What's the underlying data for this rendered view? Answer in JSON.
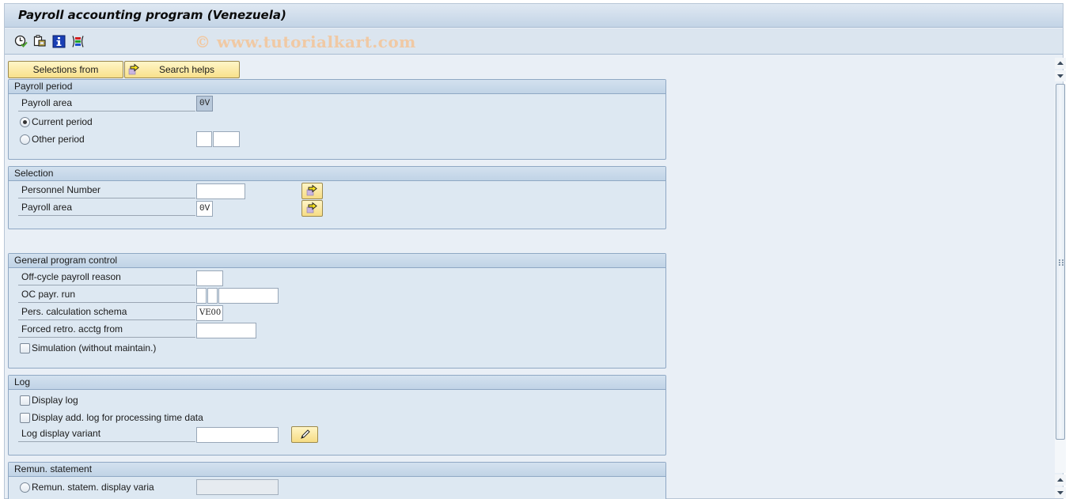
{
  "window": {
    "title": "Payroll accounting program (Venezuela)",
    "watermark": "© www.tutorialkart.com"
  },
  "toolbar": {
    "icons": [
      "execute-clock-icon",
      "copy-variant-icon",
      "info-icon",
      "selection-options-icon"
    ]
  },
  "buttons": {
    "selections_from": "Selections from",
    "search_helps": "Search helps"
  },
  "payroll_period": {
    "title": "Payroll period",
    "payroll_area_label": "Payroll area",
    "payroll_area_value": "0V",
    "current_period_label": "Current period",
    "current_period_selected": true,
    "other_period_label": "Other period",
    "other_period_selected": false,
    "other_period_value_1": "",
    "other_period_value_2": ""
  },
  "selection": {
    "title": "Selection",
    "personnel_number_label": "Personnel Number",
    "personnel_number_value": "",
    "payroll_area_label": "Payroll area",
    "payroll_area_value": "0V"
  },
  "general_control": {
    "title": "General program control",
    "offcycle_reason_label": "Off-cycle payroll reason",
    "offcycle_reason_value": "",
    "oc_run_label": "OC payr. run",
    "oc_run_values": [
      "",
      "",
      ""
    ],
    "schema_label": "Pers. calculation schema",
    "schema_value": "VE00",
    "forced_retro_label": "Forced retro. acctg from",
    "forced_retro_value": "",
    "simulation_label": "Simulation (without maintain.)",
    "simulation_checked": false
  },
  "log": {
    "title": "Log",
    "display_log_label": "Display log",
    "display_log_checked": false,
    "display_add_log_label": "Display add. log for processing time data",
    "display_add_log_checked": false,
    "variant_label": "Log display variant",
    "variant_value": ""
  },
  "remun": {
    "title": "Remun. statement",
    "display_variant_label": "Remun. statem. display varia",
    "display_variant_selected": false,
    "display_variant_value": ""
  }
}
